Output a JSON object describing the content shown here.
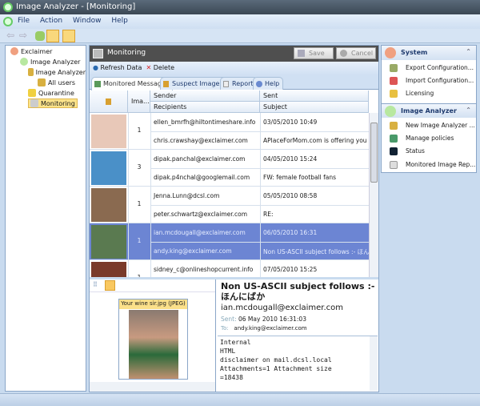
{
  "window": {
    "title": "Image Analyzer - [Monitoring]"
  },
  "menu": [
    "File",
    "Action",
    "Window",
    "Help"
  ],
  "tree": {
    "items": [
      {
        "label": "Exclaimer"
      },
      {
        "label": "Image Analyzer"
      },
      {
        "label": "Image Analyzer"
      },
      {
        "label": "All users"
      },
      {
        "label": "Quarantine"
      },
      {
        "label": "Monitoring"
      }
    ]
  },
  "panel": {
    "title": "Monitoring",
    "save": "Save",
    "cancel": "Cancel",
    "refresh": "Refresh Data",
    "delete": "Delete"
  },
  "tabs": [
    "Monitored Messages",
    "Suspect Images",
    "Report",
    "Help"
  ],
  "grid": {
    "headers": {
      "images": "Ima...",
      "sender": "Sender",
      "recipients": "Recipients",
      "sent": "Sent",
      "subject": "Subject"
    },
    "rows": [
      {
        "count": "1",
        "sender": "ellen_bmrfh@hiltontimeshare.info",
        "recipients": "chris.crawshay@exclaimer.com",
        "sent": "03/05/2010 10:49",
        "subject": "APlaceForMom.com is offering you help",
        "thumb": "#e8c8b8"
      },
      {
        "count": "3",
        "sender": "dipak.panchal@exclaimer.com",
        "recipients": "dipak.p4nchal@googlemail.com",
        "sent": "04/05/2010 15:24",
        "subject": "FW: female football fans",
        "thumb": "#4a90c8"
      },
      {
        "count": "1",
        "sender": "Jenna.Lunn@dcsl.com",
        "recipients": "peter.schwartz@exclaimer.com",
        "sent": "05/05/2010 08:58",
        "subject": "RE:",
        "thumb": "#8a6a50"
      },
      {
        "count": "1",
        "sender": "ian.mcdougall@exclaimer.com",
        "recipients": "andy.king@exclaimer.com",
        "sent": "06/05/2010 16:31",
        "subject": "Non US-ASCII subject follows :- ほん...",
        "thumb": "#5a7a50",
        "selected": true
      },
      {
        "count": "1",
        "sender": "sidney_c@onlineshopcurrent.info",
        "recipients": "",
        "sent": "07/05/2010 15:25",
        "subject": "",
        "thumb": "#7a3a2a"
      }
    ]
  },
  "preview": {
    "image_caption": "Your wine sir.jpg (JPEG)",
    "subject": "Non US-ASCII subject follows :- ほんにばか",
    "from": "ian.mcdougall@exclaimer.com",
    "sent_label": "Sent:",
    "sent": "06 May 2010 16:31:03",
    "to_label": "To:",
    "to": "andy.king@exclaimer.com",
    "body": [
      "Internal",
      "HTML",
      "disclaimer on mail.dcsl.local",
      "Attachments=1 Attachment size",
      "=18438"
    ]
  },
  "side": {
    "system": {
      "title": "System",
      "items": [
        "Export Configuration...",
        "Import Configuration...",
        "Licensing"
      ]
    },
    "analyzer": {
      "title": "Image Analyzer",
      "items": [
        "New Image Analyzer ...",
        "Manage policies",
        "Status",
        "Monitored Image Rep..."
      ]
    }
  },
  "colors": {
    "selection": "#6c85d3",
    "header": "#4f4f4f"
  }
}
